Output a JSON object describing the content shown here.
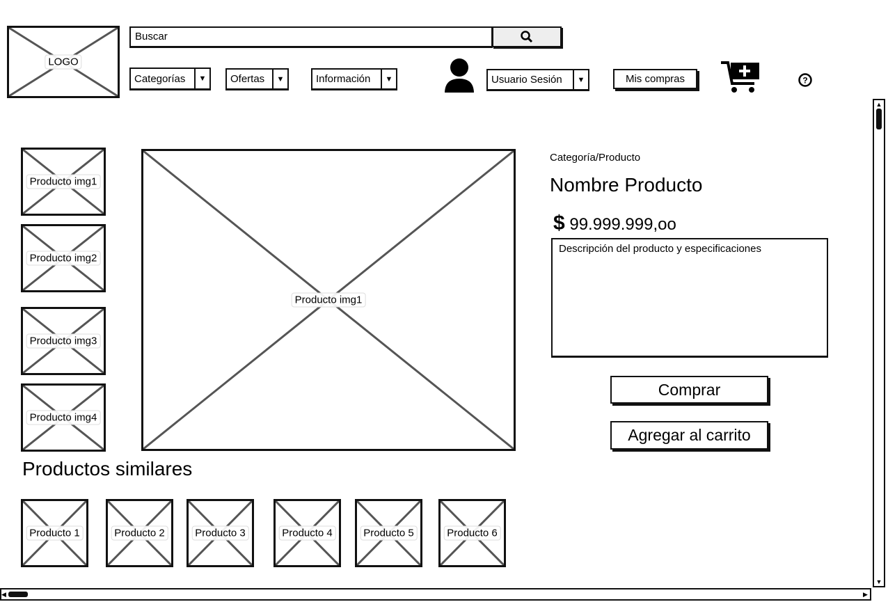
{
  "header": {
    "logo": "LOGO",
    "search": {
      "placeholder": "Buscar",
      "icon": "search-icon"
    },
    "nav": [
      {
        "label": "Categorías"
      },
      {
        "label": "Ofertas"
      },
      {
        "label": "Información"
      }
    ],
    "user": {
      "label": "Usuario Sesión",
      "icon": "user-icon"
    },
    "my_purchases": "Mis compras",
    "cart_icon": "cart-add-icon",
    "help_icon": "help-icon"
  },
  "product": {
    "thumbnails": [
      {
        "label": "Producto img1"
      },
      {
        "label": "Producto img2"
      },
      {
        "label": "Producto img3"
      },
      {
        "label": "Producto img4"
      }
    ],
    "main_image": "Producto img1",
    "breadcrumb": "Categoría/Producto",
    "name": "Nombre Producto",
    "currency": "$",
    "price": "99.999.999,oo",
    "description": "Descripción del producto y especificaciones",
    "buy": "Comprar",
    "add_to_cart": "Agregar al carrito"
  },
  "similar": {
    "title": "Productos similares",
    "items": [
      {
        "label": "Producto 1"
      },
      {
        "label": "Producto 2"
      },
      {
        "label": "Producto 3"
      },
      {
        "label": "Producto 4"
      },
      {
        "label": "Producto 5"
      },
      {
        "label": "Producto 6"
      }
    ]
  }
}
